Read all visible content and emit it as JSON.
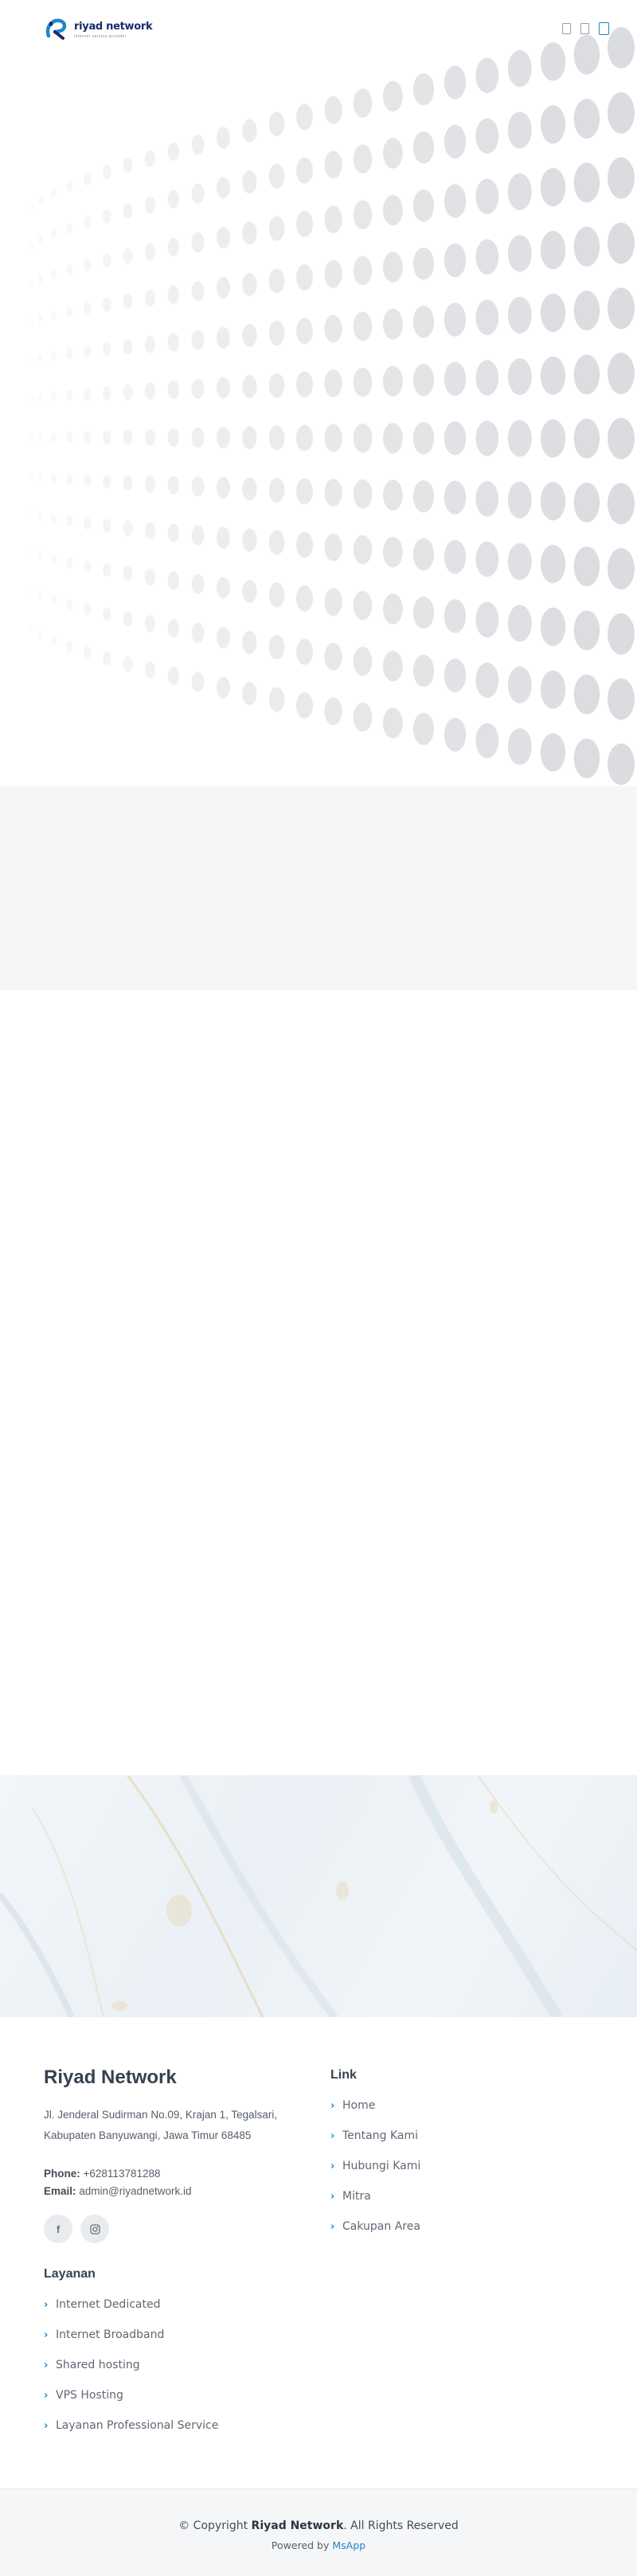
{
  "header": {
    "logo_text": "riyad network",
    "logo_tagline": "internet service provider",
    "icons": [
      "phone-icon",
      "mail-icon",
      "menu-icon"
    ]
  },
  "footer": {
    "brand": "Riyad Network",
    "address_line1": "Jl. Jenderal Sudirman No.09, Krajan 1, Tegalsari,",
    "address_line2": "Kabupaten Banyuwangi, Jawa Timur 68485",
    "phone_label": "Phone:",
    "phone_value": "+628113781288",
    "email_label": "Email:",
    "email_value": "admin@riyadnetwork.id",
    "social_icons": [
      "facebook-icon",
      "instagram-icon"
    ],
    "services_title": "Layanan",
    "services": [
      "Internet Dedicated",
      "Internet Broadband",
      "Shared hosting",
      "VPS Hosting",
      "Layanan Professional Service"
    ],
    "links_title": "Link",
    "links": [
      "Home",
      "Tentang Kami",
      "Hubungi Kami",
      "Mitra",
      "Cakupan Area"
    ]
  },
  "copyright": {
    "prefix": "© Copyright",
    "company": "Riyad Network",
    "suffix": ". All Rights Reserved",
    "powered_prefix": "Powered by",
    "powered_link": "MsApp"
  },
  "colors": {
    "accent": "#1e88c8",
    "brand_dark": "#1b2c6b",
    "heading": "#37424f",
    "band_grey": "#f5f6f8"
  }
}
